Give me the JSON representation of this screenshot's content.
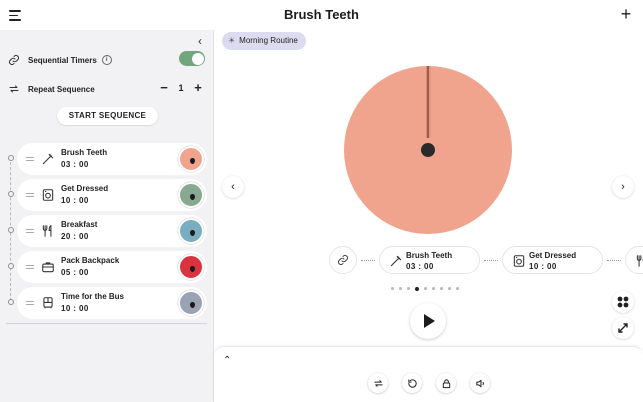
{
  "header": {
    "title": "Brush Teeth"
  },
  "sidebar": {
    "sequential_label": "Sequential Timers",
    "sequential_enabled": true,
    "repeat_label": "Repeat Sequence",
    "repeat_count": "1",
    "start_label": "START SEQUENCE",
    "timers": [
      {
        "name": "Brush Teeth",
        "duration": "03 : 00",
        "icon": "toothbrush-icon",
        "color": "#f0a48d"
      },
      {
        "name": "Get Dressed",
        "duration": "10 : 00",
        "icon": "washing-machine-icon",
        "color": "#86a98f"
      },
      {
        "name": "Breakfast",
        "duration": "20 : 00",
        "icon": "utensils-icon",
        "color": "#79aec2"
      },
      {
        "name": "Pack Backpack",
        "duration": "05 : 00",
        "icon": "briefcase-icon",
        "color": "#d8333f"
      },
      {
        "name": "Time for the Bus",
        "duration": "10 : 00",
        "icon": "bus-icon",
        "color": "#9aa3b3"
      }
    ]
  },
  "main": {
    "routine_chip": "Morning Routine",
    "dial_color": "#f0a48d",
    "strip": [
      {
        "name": "Brush Teeth",
        "duration": "03 : 00"
      },
      {
        "name": "Get Dressed",
        "duration": "10 : 00"
      }
    ],
    "pager": {
      "count": 9,
      "active": 3
    }
  }
}
